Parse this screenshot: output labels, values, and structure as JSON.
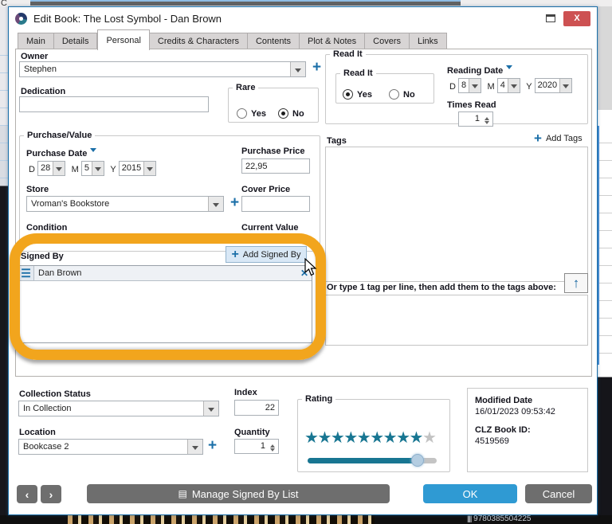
{
  "colors": {
    "accent": "#1b6fa8",
    "ok_blue": "#2f9ad3",
    "button_gray": "#6e6e6e",
    "star_teal": "#187692",
    "annotation_orange": "#f2a51d",
    "close_red": "#cd5152"
  },
  "background": {
    "top_fragment": "C",
    "isbn": "9780385504225"
  },
  "window": {
    "title": "Edit Book: The Lost Symbol - Dan Brown",
    "close_label": "X"
  },
  "tabs": {
    "active": "Personal",
    "items": [
      "Main",
      "Details",
      "Personal",
      "Credits & Characters",
      "Contents",
      "Plot & Notes",
      "Covers",
      "Links"
    ]
  },
  "owner": {
    "label": "Owner",
    "value": "Stephen"
  },
  "dedication": {
    "label": "Dedication",
    "value": ""
  },
  "rare": {
    "legend": "Rare",
    "yes": "Yes",
    "no": "No",
    "selected": "No"
  },
  "read_it": {
    "legend": "Read It",
    "inner_legend": "Read It",
    "yes": "Yes",
    "no": "No",
    "selected": "Yes",
    "reading_date": {
      "label": "Reading Date",
      "d_label": "D",
      "d": "8",
      "m_label": "M",
      "m": "4",
      "y_label": "Y",
      "y": "2020"
    },
    "times_read": {
      "label": "Times Read",
      "value": "1"
    }
  },
  "purchase": {
    "legend": "Purchase/Value",
    "purchase_date": {
      "label": "Purchase Date",
      "d_label": "D",
      "d": "28",
      "m_label": "M",
      "m": "5",
      "y_label": "Y",
      "y": "2015"
    },
    "purchase_price": {
      "label": "Purchase Price",
      "value": "22,95"
    },
    "store": {
      "label": "Store",
      "value": "Vroman's Bookstore"
    },
    "cover_price": {
      "label": "Cover Price",
      "value": ""
    },
    "condition_label": "Condition",
    "current_value_label": "Current Value"
  },
  "signed_by": {
    "label": "Signed By",
    "add_button": "Add Signed By",
    "items": [
      {
        "name": "Dan Brown"
      }
    ]
  },
  "tags": {
    "label": "Tags",
    "add_button": "Add Tags",
    "value": "",
    "hint": "Or type 1 tag per line, then add them to the tags above:",
    "textarea_value": ""
  },
  "collection_status": {
    "label": "Collection Status",
    "value": "In Collection"
  },
  "index": {
    "label": "Index",
    "value": "22"
  },
  "location": {
    "label": "Location",
    "value": "Bookcase 2"
  },
  "quantity": {
    "label": "Quantity",
    "value": "1"
  },
  "rating": {
    "legend": "Rating",
    "stars_filled": 9,
    "stars_total": 10,
    "slider_percent": 85
  },
  "info": {
    "modified_label": "Modified Date",
    "modified_value": "16/01/2023 09:53:42",
    "id_label": "CLZ Book ID:",
    "id_value": "4519569"
  },
  "footer": {
    "prev": "‹",
    "next": "›",
    "manage": "Manage Signed By List",
    "ok": "OK",
    "cancel": "Cancel"
  }
}
